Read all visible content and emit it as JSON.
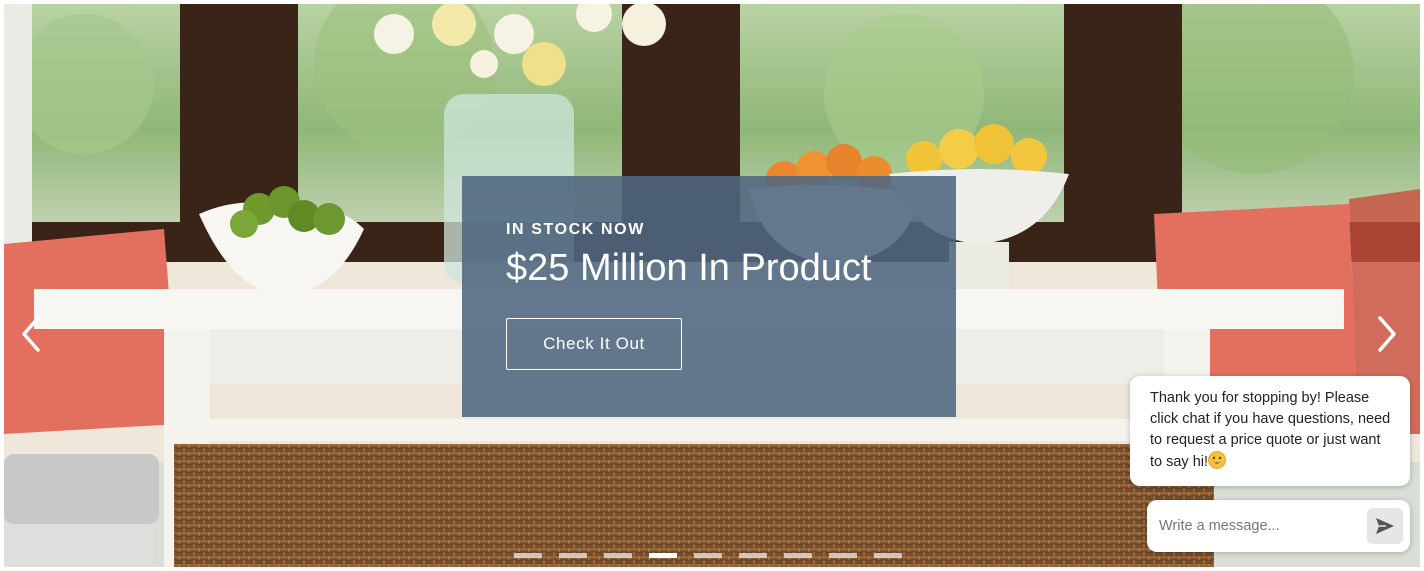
{
  "hero": {
    "eyebrow": "IN STOCK NOW",
    "headline": "$25 Million In Product",
    "cta_label": "Check It Out",
    "background_image": "sunroom-table-with-fruit-bowls-and-flowers"
  },
  "carousel": {
    "prev_icon": "chevron-left-icon",
    "next_icon": "chevron-right-icon",
    "slide_count": 9,
    "active_slide": 4
  },
  "chat": {
    "greeting": "Thank you for stopping by! Please click chat if you have questions, need to request a price quote or just want to say hi!",
    "greeting_emoji": "grinning-face-emoji",
    "input_placeholder": "Write a message...",
    "send_icon": "send-icon"
  },
  "colors": {
    "panel_overlay": "#4f6780",
    "text_light": "#ffffff",
    "window_frame": "#3a2418",
    "pillow_coral": "#e36f5e"
  }
}
